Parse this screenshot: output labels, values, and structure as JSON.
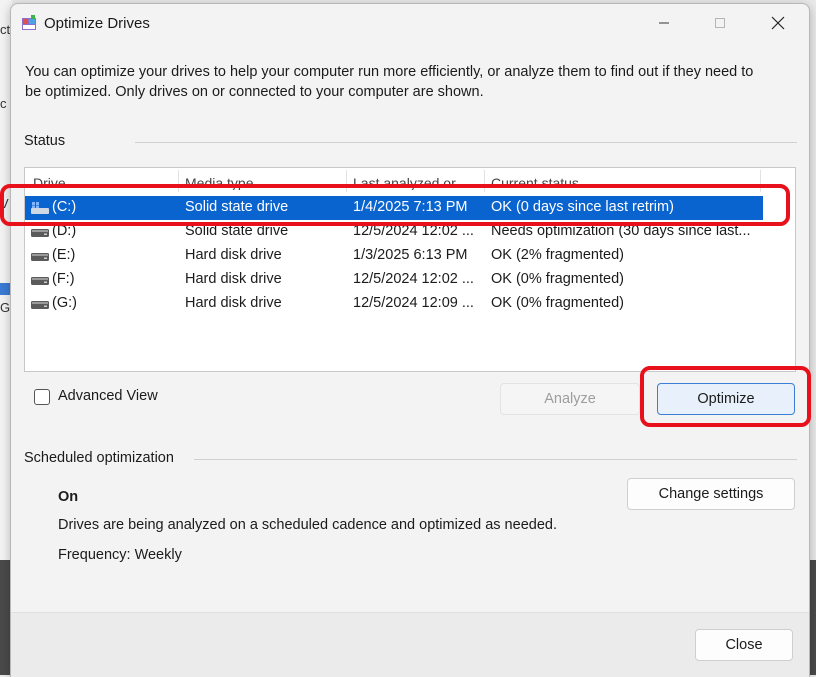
{
  "window": {
    "title": "Optimize Drives"
  },
  "description": "You can optimize your drives to help your computer run more efficiently, or analyze them to find out if they need to be optimized. Only drives on or connected to your computer are shown.",
  "status": {
    "section_label": "Status",
    "columns": [
      "Drive",
      "Media type",
      "Last analyzed or ...",
      "Current status"
    ],
    "drives": [
      {
        "drive": "(C:)",
        "media_type": "Solid state drive",
        "last_analyzed": "1/4/2025 7:13 PM",
        "status": "OK (0 days since last retrim)",
        "icon": "windows-drive-icon",
        "selected": true
      },
      {
        "drive": "(D:)",
        "media_type": "Solid state drive",
        "last_analyzed": "12/5/2024 12:02 ...",
        "status": "Needs optimization (30 days since last...",
        "icon": "drive-icon",
        "selected": false
      },
      {
        "drive": "(E:)",
        "media_type": "Hard disk drive",
        "last_analyzed": "1/3/2025 6:13 PM",
        "status": "OK (2% fragmented)",
        "icon": "drive-icon",
        "selected": false
      },
      {
        "drive": "(F:)",
        "media_type": "Hard disk drive",
        "last_analyzed": "12/5/2024 12:02 ...",
        "status": "OK (0% fragmented)",
        "icon": "drive-icon",
        "selected": false
      },
      {
        "drive": "(G:)",
        "media_type": "Hard disk drive",
        "last_analyzed": "12/5/2024 12:09 ...",
        "status": "OK (0% fragmented)",
        "icon": "drive-icon",
        "selected": false
      }
    ]
  },
  "advanced_view": {
    "label": "Advanced View",
    "checked": false
  },
  "buttons": {
    "analyze": "Analyze",
    "optimize": "Optimize",
    "change_settings": "Change settings",
    "close": "Close"
  },
  "scheduled": {
    "section_label": "Scheduled optimization",
    "state": "On",
    "description": "Drives are being analyzed on a scheduled cadence and optimized as needed.",
    "frequency": "Frequency: Weekly"
  },
  "colors": {
    "selection": "#0a64d0",
    "highlight_outline": "#e8111b",
    "primary_button_border": "#3a7ed8"
  }
}
